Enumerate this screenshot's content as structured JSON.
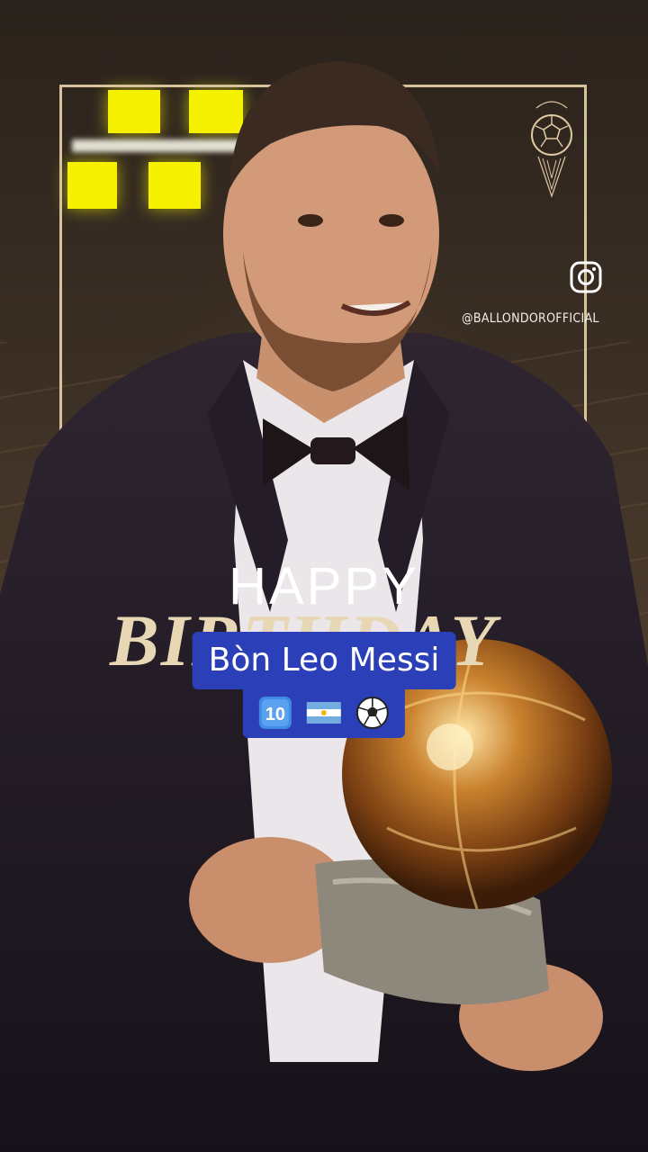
{
  "overlay": {
    "instagram_handle": "@BALLONDOROFFICIAL",
    "happy": "HAPPY",
    "birthday": "BIRTHDAY"
  },
  "caption": {
    "line1": "Bòn Leo Messi",
    "line2_emojis": [
      "keycap-ten-icon",
      "argentina-flag-icon",
      "soccer-ball-icon"
    ]
  },
  "colors": {
    "frame": "#d8c29b",
    "caption_bg": "#2a3fb8",
    "stage_lights": "#f5f100"
  }
}
